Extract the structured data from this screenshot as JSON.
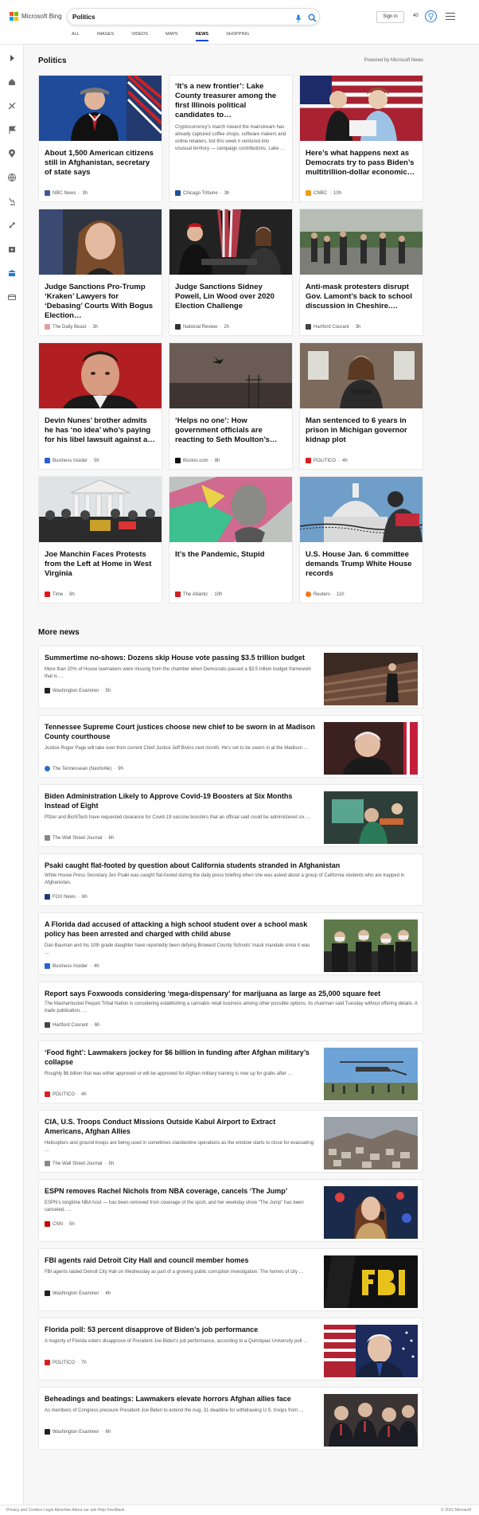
{
  "header": {
    "brand": "Microsoft Bing",
    "query": "Politics",
    "signin": "Sign in",
    "points": "40",
    "tabs": [
      {
        "label": "ALL"
      },
      {
        "label": "IMAGES"
      },
      {
        "label": "VIDEOS"
      },
      {
        "label": "MAPS"
      },
      {
        "label": "NEWS"
      },
      {
        "label": "SHOPPING"
      }
    ],
    "active_tab": "NEWS"
  },
  "sidebar": {
    "icons": [
      "expand-icon",
      "home-icon",
      "sports-icon",
      "flag-icon",
      "location-icon",
      "globe-icon",
      "science-icon",
      "rocket-icon",
      "entertainment-icon",
      "politics-icon",
      "money-icon"
    ]
  },
  "page": {
    "title": "Politics",
    "powered_by": "Powered by Microsoft News",
    "more_news": "More news"
  },
  "cards": [
    {
      "title": "About 1,500 American citizens still in Afghanistan, secretary of state says",
      "source": "NBC News",
      "age": "3h",
      "snippet": "",
      "favicon_color": "#3b5998"
    },
    {
      "title": "‘It’s a new frontier’: Lake County treasurer among the first Illinois political candidates to…",
      "source": "Chicago Tribune",
      "age": "3h",
      "snippet": "Cryptocurrency’s march toward the mainstream has already captured coffee shops, software makers and online retailers, but this week it ventured into unusual territory — campaign contributions. Lake …",
      "favicon_color": "#1f4e9c"
    },
    {
      "title": "Here’s what happens next as Democrats try to pass Biden’s multitrillion-dollar economic…",
      "source": "CNBC",
      "age": "10h",
      "snippet": "",
      "favicon_color": "#f09a1a"
    },
    {
      "title": "Judge Sanctions Pro-Trump ‘Kraken’ Lawyers for ‘Debasing’ Courts With Bogus Election…",
      "source": "The Daily Beast",
      "age": "3h",
      "snippet": "",
      "favicon_color": "#e2a0a0"
    },
    {
      "title": "Judge Sanctions Sidney Powell, Lin Wood over 2020 Election Challenge",
      "source": "National Review",
      "age": "2h",
      "snippet": "",
      "favicon_color": "#333333"
    },
    {
      "title": "Anti-mask protesters disrupt Gov. Lamont’s back to school discussion in Cheshire.…",
      "source": "Hartford Courant",
      "age": "3h",
      "snippet": "",
      "favicon_color": "#444444"
    },
    {
      "title": "Devin Nunes’ brother admits he has ‘no idea’ who’s paying for his libel lawsuit against a…",
      "source": "Business Insider",
      "age": "5h",
      "snippet": "",
      "favicon_color": "#2b5fd9"
    },
    {
      "title": "‘Helps no one’: How government officials are reacting to Seth Moulton’s…",
      "source": "Boston.com",
      "age": "8h",
      "snippet": "",
      "favicon_color": "#111111"
    },
    {
      "title": "Man sentenced to 6 years in prison in Michigan governor kidnap plot",
      "source": "POLITICO",
      "age": "4h",
      "snippet": "",
      "favicon_color": "#d92020"
    },
    {
      "title": "Joe Manchin Faces Protests from the Left at Home in West Virginia",
      "source": "Time",
      "age": "8h",
      "snippet": "",
      "favicon_color": "#e01a1a"
    },
    {
      "title": "It’s the Pandemic, Stupid",
      "source": "The Atlantic",
      "age": "10h",
      "snippet": "",
      "favicon_color": "#d02020"
    },
    {
      "title": "U.S. House Jan. 6 committee demands Trump White House records",
      "source": "Reuters",
      "age": "11h",
      "snippet": "",
      "favicon_color": "#f07a1a"
    }
  ],
  "more_items": [
    {
      "title": "Summertime no-shows: Dozens skip House vote passing $3.5 trillion budget",
      "snippet": "More than 20% of House lawmakers were missing from the chamber when Democrats passed a $3.5 trillion budget framework that is …",
      "source": "Washington Examiner",
      "age": "5h",
      "favicon_color": "#222222",
      "has_thumb": true
    },
    {
      "title": "Tennessee Supreme Court justices choose new chief to be sworn in at Madison County courthouse",
      "snippet": "Justice Roger Page will take over from current Chief Justice Jeff Bivins next month. He’s set to be sworn in at the Madison …",
      "source": "The Tennessean (Nashville)",
      "age": "9h",
      "favicon_color": "#2a6ec9",
      "has_thumb": true
    },
    {
      "title": "Biden Administration Likely to Approve Covid-19 Boosters at Six Months Instead of Eight",
      "snippet": "Pfizer and BioNTech have requested clearance for Covid-19 vaccine boosters that an official said could be administered six …",
      "source": "The Wall Street Journal",
      "age": "6h",
      "favicon_color": "#888888",
      "has_thumb": true
    },
    {
      "title": "Psaki caught flat-footed by question about California students stranded in Afghanistan",
      "snippet": "White House Press Secretary Jen Psaki was caught flat-footed during the daily press briefing when she was asked about a group of California students who are trapped in Afghanistan.",
      "source": "FOX News",
      "age": "6h",
      "favicon_color": "#1a3a7a",
      "has_thumb": false
    },
    {
      "title": "A Florida dad accused of attacking a high school student over a school mask policy has been arrested and charged with child abuse",
      "snippet": "Dan Bauman and his 10th grade daughter have reportedly been defying Broward County Schools’ mask mandate since it was …",
      "source": "Business Insider",
      "age": "4h",
      "favicon_color": "#2b5fd9",
      "has_thumb": true
    },
    {
      "title": "Report says Foxwoods considering ‘mega-dispensary’ for marijuana as large as 25,000 square feet",
      "snippet": "The Mashantucket Pequot Tribal Nation is considering establishing a cannabis retail business among other possible options, its chairman said Tuesday without offering details. A trade publication, …",
      "source": "Hartford Courant",
      "age": "6h",
      "favicon_color": "#444444",
      "has_thumb": false
    },
    {
      "title": "‘Food fight’: Lawmakers jockey for $6 billion in funding after Afghan military’s collapse",
      "snippet": "Roughly $6 billion that was either approved or will be approved for Afghan military training is now up for grabs after …",
      "source": "POLITICO",
      "age": "4h",
      "favicon_color": "#d92020",
      "has_thumb": true
    },
    {
      "title": "CIA, U.S. Troops Conduct Missions Outside Kabul Airport to Extract Americans, Afghan Allies",
      "snippet": "Helicopters and ground troops are being used in sometimes clandestine operations as the window starts to close for evacuating …",
      "source": "The Wall Street Journal",
      "age": "5h",
      "favicon_color": "#888888",
      "has_thumb": true
    },
    {
      "title": "ESPN removes Rachel Nichols from NBA coverage, cancels ‘The Jump’",
      "snippet": "ESPN’s longtime NBA host — has been removed from coverage of the sport, and her weekday show “The Jump” has been canceled, …",
      "source": "CNN",
      "age": "5h",
      "favicon_color": "#cc0000",
      "has_thumb": true
    },
    {
      "title": "FBI agents raid Detroit City Hall and council member homes",
      "snippet": "FBI agents raided Detroit City Hall on Wednesday as part of a growing public corruption investigation. The homes of city …",
      "source": "Washington Examiner",
      "age": "4h",
      "favicon_color": "#222222",
      "has_thumb": true
    },
    {
      "title": "Florida poll: 53 percent disapprove of Biden’s job performance",
      "snippet": "A majority of Florida voters disapprove of President Joe Biden’s job performance, according to a Quinnipiac University poll …",
      "source": "POLITICO",
      "age": "7h",
      "favicon_color": "#d92020",
      "has_thumb": true
    },
    {
      "title": "Beheadings and beatings: Lawmakers elevate horrors Afghan allies face",
      "snippet": "As members of Congress pressure President Joe Biden to extend the Aug. 31 deadline for withdrawing U.S. troops from …",
      "source": "Washington Examiner",
      "age": "6h",
      "favicon_color": "#222222",
      "has_thumb": true
    }
  ],
  "footer": {
    "left": "Privacy and Cookies   Legal   Advertise   About our ads   Help   Feedback",
    "right": "© 2021 Microsoft"
  }
}
